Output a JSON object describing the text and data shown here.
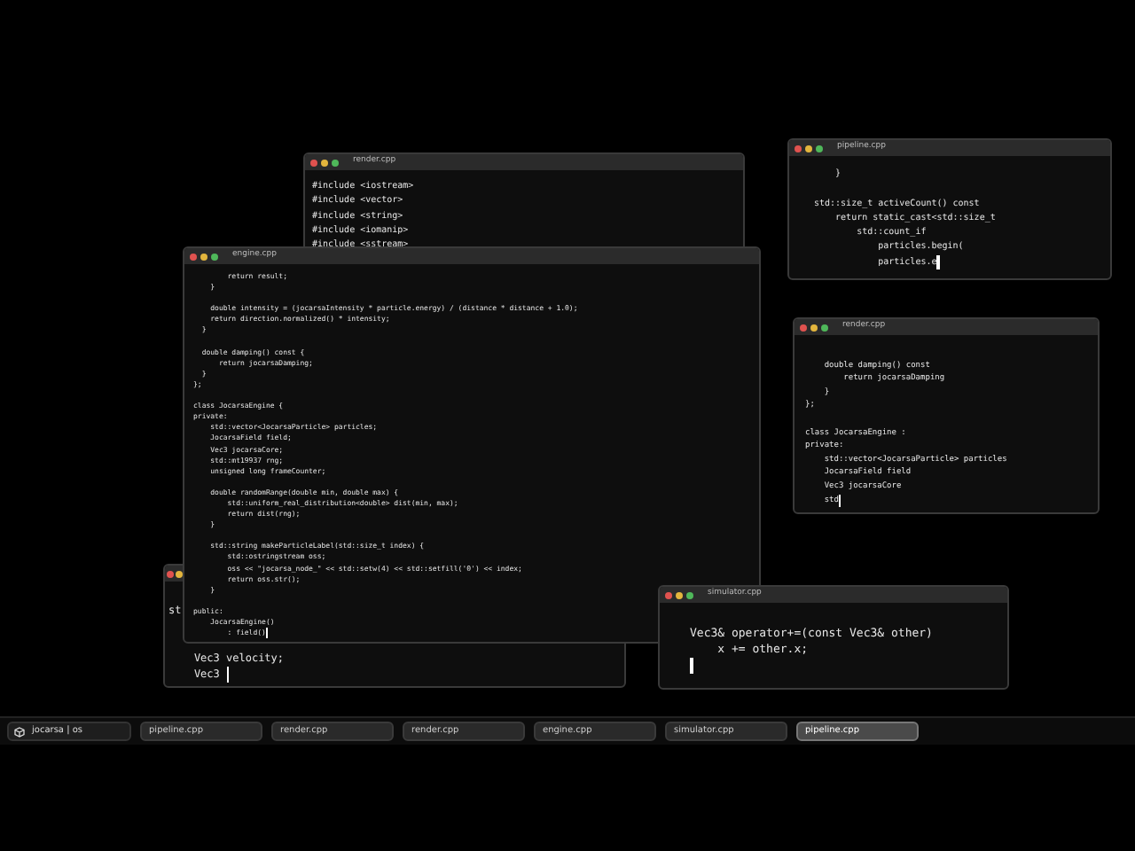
{
  "windows": [
    {
      "title": "render.cpp",
      "cursor": false,
      "lines": [
        {
          "kind": "code",
          "text": "#include <iostream>"
        },
        {
          "kind": "code",
          "text": "#include <vector>"
        },
        {
          "kind": "code",
          "text": "#include <string>"
        },
        {
          "kind": "code",
          "text": "#include <iomanip>"
        },
        {
          "kind": "code",
          "text": "#include <sstream>"
        }
      ]
    },
    {
      "title": "pipeline.cpp",
      "cursor": true,
      "lines": [
        {
          "kind": "code",
          "text": "    }"
        },
        {
          "kind": "blank"
        },
        {
          "kind": "code",
          "text": "std::size_t activeCount() const"
        },
        {
          "kind": "code",
          "text": "    return static_cast<std::size_t"
        },
        {
          "kind": "code",
          "text": "        std::count_if"
        },
        {
          "kind": "code",
          "text": "            particles.begin("
        },
        {
          "kind": "code",
          "text": "            particles.e"
        }
      ]
    },
    {
      "title": "render.cpp",
      "cursor": true,
      "lines": [
        {
          "kind": "blank"
        },
        {
          "kind": "code",
          "text": "    double damping() const"
        },
        {
          "kind": "code",
          "text": "        return jocarsaDamping"
        },
        {
          "kind": "code",
          "text": "    }"
        },
        {
          "kind": "code",
          "text": "};"
        },
        {
          "kind": "blank"
        },
        {
          "kind": "code",
          "text": "class JocarsaEngine :"
        },
        {
          "kind": "code",
          "text": "private:"
        },
        {
          "kind": "code",
          "text": "    std::vector<JocarsaParticle> particles"
        },
        {
          "kind": "code",
          "text": "    JocarsaField field"
        },
        {
          "kind": "code",
          "text": "    Vec3 jocarsaCore"
        },
        {
          "kind": "code",
          "text": "    std"
        }
      ]
    },
    {
      "cursor": true,
      "lines": [
        {
          "kind": "code",
          "text": "st"
        },
        {
          "kind": "blank"
        },
        {
          "kind": "blank"
        },
        {
          "kind": "code",
          "text": "    Vec3 velocity;"
        },
        {
          "kind": "code",
          "text": "    Vec3 "
        }
      ]
    },
    {
      "title": "engine.cpp",
      "cursor": true,
      "lines": [
        {
          "kind": "code",
          "text": "        return result;"
        },
        {
          "kind": "code",
          "text": "    }"
        },
        {
          "kind": "blank"
        },
        {
          "kind": "code",
          "text": "    double intensity = (jocarsaIntensity * particle.energy) / (distance * distance + 1.0);"
        },
        {
          "kind": "code",
          "text": "    return direction.normalized() * intensity;"
        },
        {
          "kind": "code",
          "text": "  }"
        },
        {
          "kind": "blank"
        },
        {
          "kind": "code",
          "text": "  double damping() const {"
        },
        {
          "kind": "code",
          "text": "      return jocarsaDamping;"
        },
        {
          "kind": "code",
          "text": "  }"
        },
        {
          "kind": "code",
          "text": "};"
        },
        {
          "kind": "blank"
        },
        {
          "kind": "code",
          "text": "class JocarsaEngine {"
        },
        {
          "kind": "code",
          "text": "private:"
        },
        {
          "kind": "code",
          "text": "    std::vector<JocarsaParticle> particles;"
        },
        {
          "kind": "code",
          "text": "    JocarsaField field;"
        },
        {
          "kind": "code",
          "text": "    Vec3 jocarsaCore;"
        },
        {
          "kind": "code",
          "text": "    std::mt19937 rng;"
        },
        {
          "kind": "code",
          "text": "    unsigned long frameCounter;"
        },
        {
          "kind": "blank"
        },
        {
          "kind": "code",
          "text": "    double randomRange(double min, double max) {"
        },
        {
          "kind": "code",
          "text": "        std::uniform_real_distribution<double> dist(min, max);"
        },
        {
          "kind": "code",
          "text": "        return dist(rng);"
        },
        {
          "kind": "code",
          "text": "    }"
        },
        {
          "kind": "blank"
        },
        {
          "kind": "code",
          "text": "    std::string makeParticleLabel(std::size_t index) {"
        },
        {
          "kind": "code",
          "text": "        std::ostringstream oss;"
        },
        {
          "kind": "code",
          "text": "        oss << \"jocarsa_node_\" << std::setw(4) << std::setfill('0') << index;"
        },
        {
          "kind": "code",
          "text": "        return oss.str();"
        },
        {
          "kind": "code",
          "text": "    }"
        },
        {
          "kind": "blank"
        },
        {
          "kind": "code",
          "text": "public:"
        },
        {
          "kind": "code",
          "text": "    JocarsaEngine()"
        },
        {
          "kind": "code",
          "text": "        : field()"
        }
      ]
    },
    {
      "title": "simulator.cpp",
      "cursor": true,
      "lines": [
        {
          "kind": "blank"
        },
        {
          "kind": "code",
          "text": "Vec3& operator+=(const Vec3& other)"
        },
        {
          "kind": "code",
          "text": "    x += other.x;"
        },
        {
          "kind": "blank"
        }
      ]
    }
  ],
  "taskbar": {
    "start": "jocarsa | os",
    "items": [
      {
        "label": "pipeline.cpp",
        "selected": false
      },
      {
        "label": "render.cpp",
        "selected": false
      },
      {
        "label": "render.cpp",
        "selected": false
      },
      {
        "label": "engine.cpp",
        "selected": false
      },
      {
        "label": "simulator.cpp",
        "selected": false
      },
      {
        "label": "pipeline.cpp",
        "selected": true
      }
    ]
  }
}
